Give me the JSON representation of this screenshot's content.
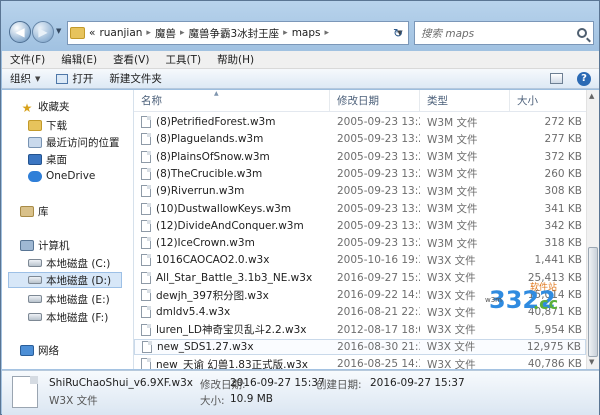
{
  "address": {
    "overflow": "«",
    "crumbs": [
      "ruanjian",
      "魔兽",
      "魔兽争霸3冰封王座",
      "maps"
    ]
  },
  "search": {
    "placeholder": "搜索 maps"
  },
  "menu": [
    "文件(F)",
    "编辑(E)",
    "查看(V)",
    "工具(T)",
    "帮助(H)"
  ],
  "toolbar": {
    "organize": "组织",
    "open": "打开",
    "new_folder": "新建文件夹"
  },
  "sidebar": {
    "favorites": "收藏夹",
    "downloads": "下载",
    "recent": "最近访问的位置",
    "desktop": "桌面",
    "onedrive": "OneDrive",
    "library": "库",
    "computer": "计算机",
    "drive_c": "本地磁盘 (C:)",
    "drive_d": "本地磁盘 (D:)",
    "drive_e": "本地磁盘 (E:)",
    "drive_f": "本地磁盘 (F:)",
    "network": "网络"
  },
  "columns": {
    "name": "名称",
    "date": "修改日期",
    "type": "类型",
    "size": "大小"
  },
  "files": [
    {
      "name": "(8)PetrifiedForest.w3m",
      "date": "2005-09-23 13:25",
      "type": "W3M 文件",
      "size": "272 KB"
    },
    {
      "name": "(8)Plaguelands.w3m",
      "date": "2005-09-23 13:25",
      "type": "W3M 文件",
      "size": "277 KB"
    },
    {
      "name": "(8)PlainsOfSnow.w3m",
      "date": "2005-09-23 13:25",
      "type": "W3M 文件",
      "size": "372 KB"
    },
    {
      "name": "(8)TheCrucible.w3m",
      "date": "2005-09-23 13:25",
      "type": "W3M 文件",
      "size": "260 KB"
    },
    {
      "name": "(9)Riverrun.w3m",
      "date": "2005-09-23 13:25",
      "type": "W3M 文件",
      "size": "308 KB"
    },
    {
      "name": "(10)DustwallowKeys.w3m",
      "date": "2005-09-23 13:25",
      "type": "W3M 文件",
      "size": "341 KB"
    },
    {
      "name": "(12)DivideAndConquer.w3m",
      "date": "2005-09-23 13:25",
      "type": "W3M 文件",
      "size": "342 KB"
    },
    {
      "name": "(12)IceCrown.w3m",
      "date": "2005-09-23 13:25",
      "type": "W3M 文件",
      "size": "318 KB"
    },
    {
      "name": "1016CAOCAO2.0.w3x",
      "date": "2005-10-16 19:36",
      "type": "W3X 文件",
      "size": "1,441 KB"
    },
    {
      "name": "All_Star_Battle_3.1b3_NE.w3x",
      "date": "2016-09-27 15:24",
      "type": "W3X 文件",
      "size": "25,413 KB"
    },
    {
      "name": "dewjh_397积分图.w3x",
      "date": "2016-09-22 14:52",
      "type": "W3X 文件",
      "size": "15,014 KB"
    },
    {
      "name": "dmldv5.4.w3x",
      "date": "2016-08-21 22:39",
      "type": "W3X 文件",
      "size": "40,871 KB"
    },
    {
      "name": "luren_LD神奇宝贝乱斗2.2.w3x",
      "date": "2012-08-17 18:01",
      "type": "W3X 文件",
      "size": "5,954 KB"
    },
    {
      "name": "new_SDS1.27.w3x",
      "date": "2016-08-30 21:30",
      "type": "W3X 文件",
      "size": "12,975 KB"
    },
    {
      "name": "new_天谕 幻兽1.83正式版.w3x",
      "date": "2016-08-25 14:38",
      "type": "W3X 文件",
      "size": "40,786 KB"
    },
    {
      "name": "ShiRuChaoShui_v6.9XF.w3x",
      "date": "2016-09-27 15:37",
      "type": "W3X 文件",
      "size": "11,245 KB"
    }
  ],
  "details": {
    "name": "ShiRuChaoShui_v6.9XF.w3x",
    "type": "W3X 文件",
    "modified_label": "修改日期:",
    "modified_value": "2016-09-27 15:37",
    "size_label": "大小:",
    "size_value": "10.9 MB",
    "created_label": "创建日期:",
    "created_value": "2016-09-27 15:37"
  },
  "watermark": {
    "digits": "3322",
    "domain": ".cc",
    "tagline": "软件站",
    "sub": "w3m"
  }
}
